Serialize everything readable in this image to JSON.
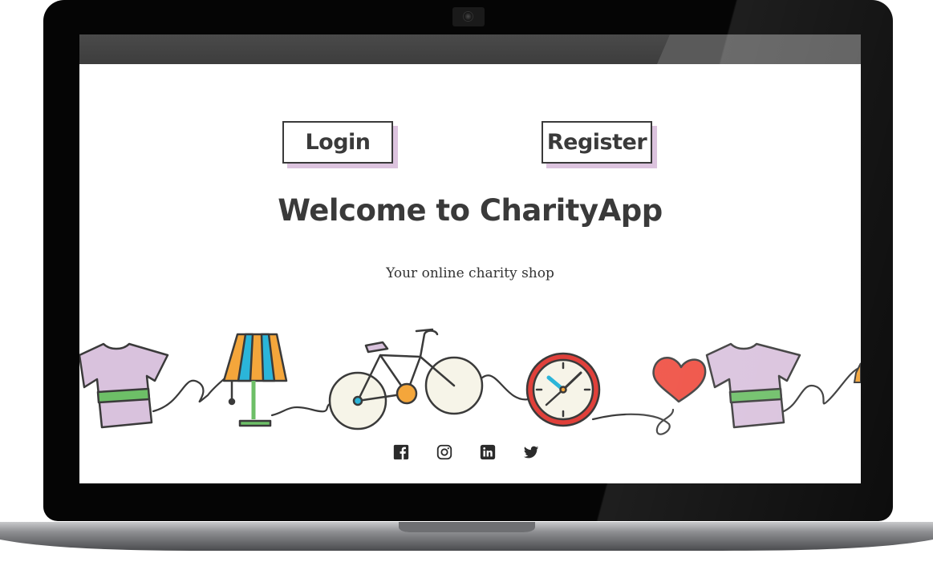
{
  "buttons": {
    "login_label": "Login",
    "register_label": "Register"
  },
  "hero": {
    "title": "Welcome to CharityApp",
    "subtitle": "Your online charity shop"
  },
  "social_icons": [
    "facebook-icon",
    "instagram-icon",
    "linkedin-icon",
    "twitter-icon"
  ],
  "colors": {
    "text_dark": "#3a3a3a",
    "button_shadow": "#dcc3de",
    "shirt": "#d9c2dd",
    "stripe": "#6dbf67",
    "lamp_orange": "#f4a63b",
    "lamp_blue": "#2bb5d9",
    "clock_red": "#e0403a",
    "heart_red": "#ef4b3e",
    "bike_cream": "#f6f4e8"
  }
}
